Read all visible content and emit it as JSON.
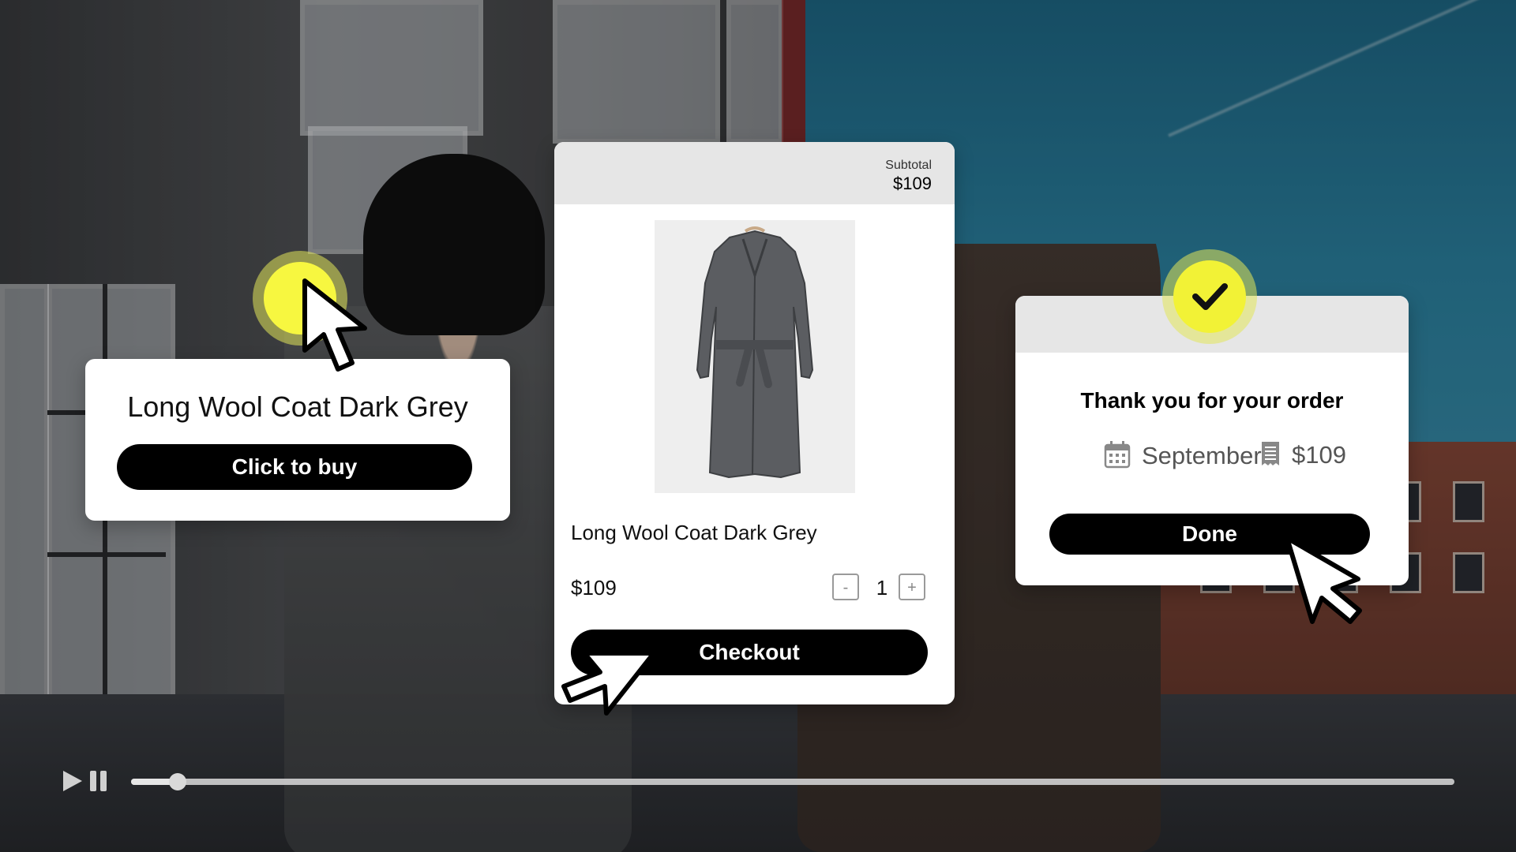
{
  "product_card": {
    "title": "Long Wool Coat Dark Grey",
    "buy_button": "Click to buy"
  },
  "cart_card": {
    "subtotal_label": "Subtotal",
    "subtotal_value": "$109",
    "product_image_icon": "coat-image",
    "product_name": "Long Wool Coat Dark Grey",
    "price": "$109",
    "qty_minus": "-",
    "quantity": "1",
    "qty_plus": "+",
    "checkout_button": "Checkout"
  },
  "confirmation_card": {
    "title": "Thank you for your order",
    "month_icon": "calendar-icon",
    "month": "September",
    "amount_icon": "receipt-icon",
    "amount": "$109",
    "done_button": "Done",
    "badge_icon": "check-icon"
  },
  "video_controls": {
    "play_icon": "play-icon",
    "pause_icon": "pause-icon",
    "progress": 0.035
  },
  "colors": {
    "accent_yellow": "#f2f236",
    "button_black": "#000000",
    "card_header_grey": "#e6e6e6"
  }
}
